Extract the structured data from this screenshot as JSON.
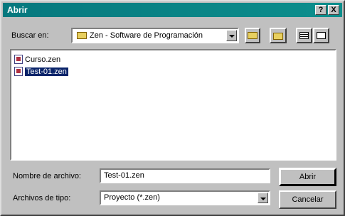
{
  "window": {
    "title": "Abrir",
    "help_button": "?",
    "close_button": "X"
  },
  "toolbar": {
    "look_in_label": "Buscar en:",
    "look_in_value": "Zen - Software de Programación"
  },
  "files": [
    {
      "name": "Curso.zen",
      "selected": false
    },
    {
      "name": "Test-01.zen",
      "selected": true
    }
  ],
  "form": {
    "filename_label": "Nombre de archivo:",
    "filename_value": "Test-01.zen",
    "filetype_label": "Archivos de tipo:",
    "filetype_value": "Proyecto (*.zen)"
  },
  "buttons": {
    "open": "Abrir",
    "cancel": "Cancelar"
  },
  "colors": {
    "titlebar": "#0c8f8d",
    "selection": "#0a246a",
    "face": "#c0c0c0"
  }
}
